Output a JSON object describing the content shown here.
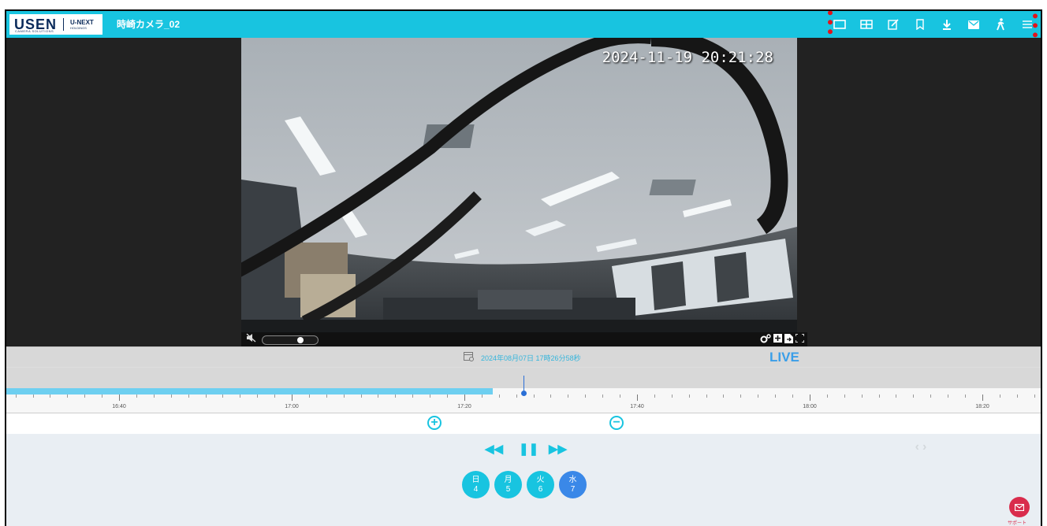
{
  "brand": {
    "name": "USEN",
    "sub": "CAMERA SOLUTIONS",
    "partner": "U-NEXT",
    "partner_sub": "HOLDINGS"
  },
  "camera_title": "時崎カメラ_02",
  "toolbar": {
    "items": [
      {
        "name": "single-view-icon",
        "label": "single view"
      },
      {
        "name": "grid-view-icon",
        "label": "grid view"
      },
      {
        "name": "edit-icon",
        "label": "edit"
      },
      {
        "name": "bookmark-icon",
        "label": "bookmark"
      },
      {
        "name": "download-icon",
        "label": "download"
      },
      {
        "name": "mail-icon",
        "label": "mail"
      },
      {
        "name": "walking-person-icon",
        "label": "person detection"
      },
      {
        "name": "menu-icon",
        "label": "menu"
      }
    ]
  },
  "video": {
    "timestamp": "2024-11-19 20:21:28",
    "volume_level": 0.72
  },
  "date_bar": {
    "date_text": "2024年08月07日 17時26分58秒",
    "live_label": "LIVE"
  },
  "timeline": {
    "labels": [
      "16:40",
      "17:00",
      "17:20",
      "17:40",
      "18:00",
      "18:20"
    ],
    "recorded_fraction": 0.47,
    "cursor_fraction": 0.5
  },
  "zoom": {
    "in_symbol": "+",
    "out_symbol": "−"
  },
  "playback": {
    "rewind": "◀◀",
    "pause": "❚❚",
    "forward": "▶▶",
    "prev": "‹",
    "next": "›"
  },
  "days": [
    {
      "weekday": "日",
      "day": "4",
      "active": false
    },
    {
      "weekday": "月",
      "day": "5",
      "active": false
    },
    {
      "weekday": "火",
      "day": "6",
      "active": false
    },
    {
      "weekday": "水",
      "day": "7",
      "active": true
    }
  ],
  "support_label": "サポート",
  "colors": {
    "accent": "#18c4e0",
    "live": "#3a9ee8",
    "highlight": "#e0141c"
  }
}
